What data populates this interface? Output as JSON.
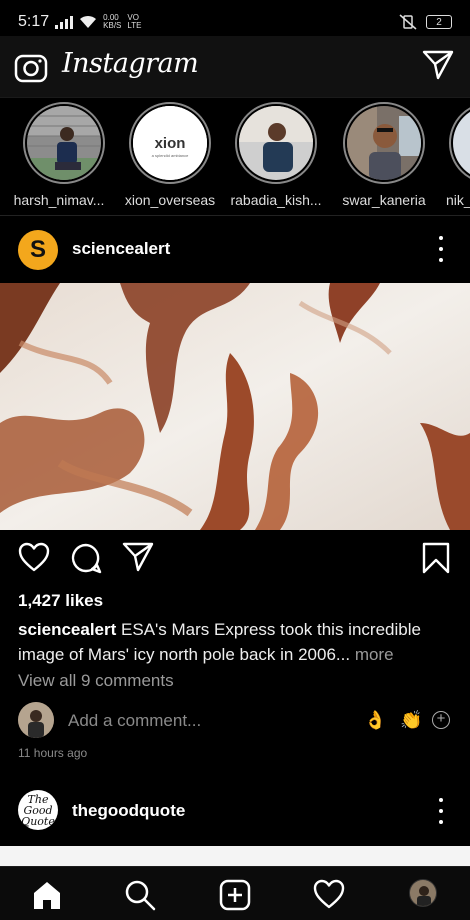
{
  "status_bar": {
    "time": "5:17",
    "net_speed": "0.00",
    "net_unit": "KB/S",
    "net_tag1": "VO",
    "net_tag2": "LTE",
    "battery": "2"
  },
  "header": {
    "title": "Instagram",
    "camera_icon": "camera-icon",
    "dm_icon": "paper-plane-icon"
  },
  "stories": [
    {
      "username": "harsh_nimav..."
    },
    {
      "username": "xion_overseas",
      "logo_text": "xion",
      "logo_sub": "a splendid ambiance"
    },
    {
      "username": "rabadia_kish..."
    },
    {
      "username": "swar_kaneria"
    },
    {
      "username": "nik_"
    }
  ],
  "post": {
    "username": "sciencealert",
    "avatar_letter": "S",
    "likes": "1,427 likes",
    "caption_user": "sciencealert",
    "caption_text": " ESA's Mars Express took this incredible image of Mars' icy north pole back in 2006...",
    "caption_more": " more",
    "view_comments": "View all 9 comments",
    "add_comment_placeholder": "Add a comment...",
    "emoji_1": "👌",
    "emoji_2": "👏",
    "time_ago": "11 hours ago"
  },
  "post2": {
    "username": "thegoodquote",
    "avatar_text": "The Good Quote"
  },
  "bottom_nav": {
    "items": [
      "home-icon",
      "search-icon",
      "add-post-icon",
      "heart-icon",
      "profile-avatar"
    ]
  },
  "colors": {
    "background": "#000000",
    "header_bg": "#111111",
    "secondary_text": "#9a9a9a",
    "sciencealert_brand": "#f3a71c"
  }
}
